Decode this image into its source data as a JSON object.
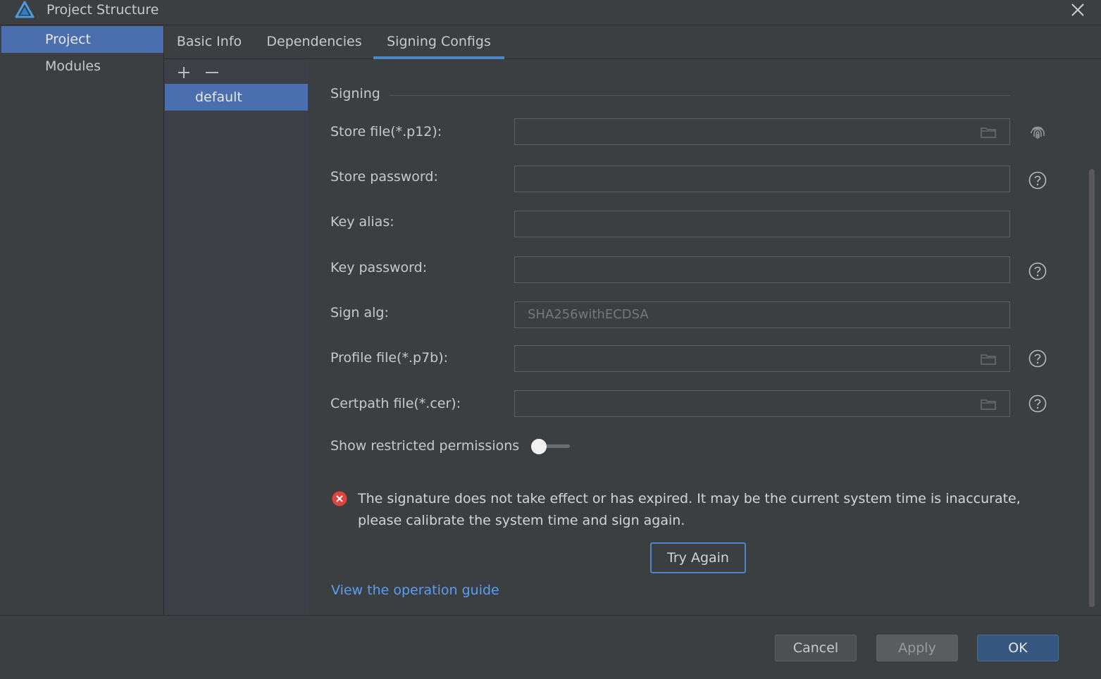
{
  "window": {
    "title": "Project Structure"
  },
  "sidebar": {
    "items": [
      {
        "label": "Project",
        "selected": true
      },
      {
        "label": "Modules",
        "selected": false
      }
    ]
  },
  "tabs": [
    {
      "label": "Basic Info",
      "active": false
    },
    {
      "label": "Dependencies",
      "active": false
    },
    {
      "label": "Signing Configs",
      "active": true
    }
  ],
  "configs": {
    "items": [
      {
        "label": "default",
        "selected": true
      }
    ]
  },
  "signing": {
    "section_title": "Signing",
    "fields": {
      "store_file": {
        "label": "Store file(*.p12):",
        "value": ""
      },
      "store_password": {
        "label": "Store password:",
        "value": ""
      },
      "key_alias": {
        "label": "Key alias:",
        "value": ""
      },
      "key_password": {
        "label": "Key password:",
        "value": ""
      },
      "sign_alg": {
        "label": "Sign alg:",
        "value": "SHA256withECDSA"
      },
      "profile_file": {
        "label": "Profile file(*.p7b):",
        "value": ""
      },
      "certpath_file": {
        "label": "Certpath file(*.cer):",
        "value": ""
      }
    },
    "restricted_permissions": {
      "label": "Show restricted permissions",
      "on": false
    },
    "error_message": "The signature does not take effect or has expired. It may be the current system time is inaccurate, please calibrate the system time and sign again.",
    "try_again_label": "Try Again",
    "guide_link": "View the operation guide"
  },
  "footer": {
    "cancel_label": "Cancel",
    "apply_label": "Apply",
    "ok_label": "OK"
  },
  "colors": {
    "selection": "#4b6eaf",
    "accent": "#4a88c7",
    "link": "#589df6",
    "error": "#e0443e"
  }
}
